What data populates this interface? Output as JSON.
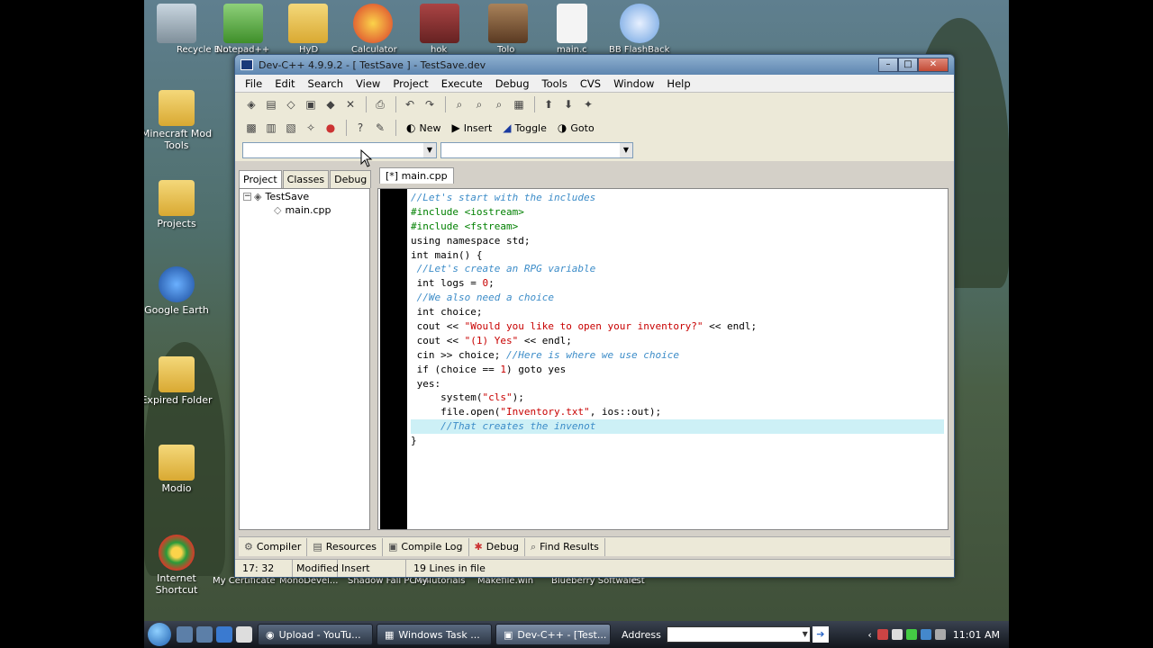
{
  "desktop": {
    "icons": [
      {
        "label": "Recycle Bin"
      },
      {
        "label": "Minecraft Mod Tools"
      },
      {
        "label": "Projects"
      },
      {
        "label": "Google Earth"
      },
      {
        "label": "Expired Folder"
      },
      {
        "label": "Modio"
      },
      {
        "label": "Internet Shortcut"
      }
    ],
    "top_labels": [
      "Notepad++",
      "HyD",
      "Calculator",
      "hok",
      "Tolo",
      "main.c",
      "BB FlashBack"
    ],
    "bottom_labels": [
      "My Certificate",
      "MonoDevel...",
      "Shadow Fall PC v4",
      "MyTutorials",
      "Makefile.win",
      "Blueberry Software",
      "Test"
    ]
  },
  "window": {
    "title": "Dev-C++ 4.9.9.2  - [ TestSave ] - TestSave.dev",
    "controls": {
      "minimize": "–",
      "maximize": "□",
      "close": "✕"
    }
  },
  "menu": [
    "File",
    "Edit",
    "Search",
    "View",
    "Project",
    "Execute",
    "Debug",
    "Tools",
    "CVS",
    "Window",
    "Help"
  ],
  "toolbar2": {
    "new_label": "New",
    "insert_label": "Insert",
    "toggle_label": "Toggle",
    "goto_label": "Goto"
  },
  "left_tabs": [
    "Project",
    "Classes",
    "Debug"
  ],
  "project_tree": {
    "root": "TestSave",
    "child": "main.cpp"
  },
  "editor": {
    "tab": "[*] main.cpp",
    "highlight_line": 17
  },
  "bottom_tabs": [
    "Compiler",
    "Resources",
    "Compile Log",
    "Debug",
    "Find Results"
  ],
  "status": {
    "position": "17: 32",
    "modified": "Modified",
    "mode": "Insert",
    "lines": "19 Lines in file"
  },
  "taskbar": {
    "tasks": [
      {
        "label": "Upload - YouTu...",
        "active": false
      },
      {
        "label": "Windows Task ...",
        "active": false
      },
      {
        "label": "Dev-C++ - [Test...",
        "active": true
      }
    ],
    "address_label": "Address",
    "clock": "11:01 AM"
  }
}
